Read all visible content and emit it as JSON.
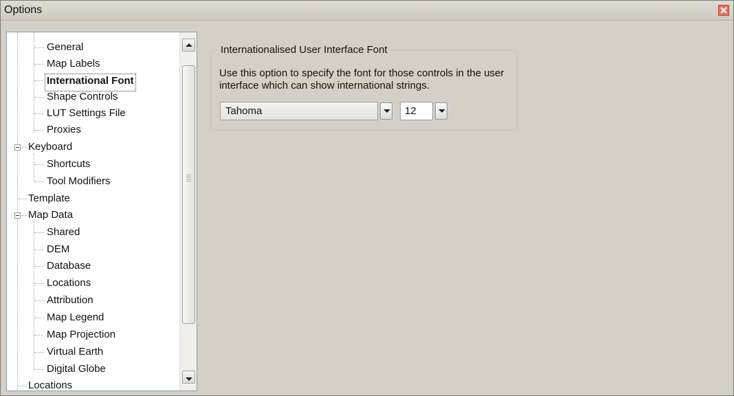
{
  "window": {
    "title": "Options"
  },
  "tree": {
    "items": [
      {
        "label": "General"
      },
      {
        "label": "Map Labels"
      },
      {
        "label": "International Font"
      },
      {
        "label": "Shape Controls"
      },
      {
        "label": "LUT Settings File"
      },
      {
        "label": "Proxies"
      },
      {
        "label": "Keyboard"
      },
      {
        "label": "Shortcuts"
      },
      {
        "label": "Tool Modifiers"
      },
      {
        "label": "Template"
      },
      {
        "label": "Map Data"
      },
      {
        "label": "Shared"
      },
      {
        "label": "DEM"
      },
      {
        "label": "Database"
      },
      {
        "label": "Locations"
      },
      {
        "label": "Attribution"
      },
      {
        "label": "Map Legend"
      },
      {
        "label": "Map Projection"
      },
      {
        "label": "Virtual Earth"
      },
      {
        "label": "Digital Globe"
      },
      {
        "label": "Locations"
      }
    ],
    "selected": "International Font"
  },
  "font_group": {
    "legend": "Internationalised User Interface Font",
    "description": "Use this option to specify the font for those controls in the user interface which can show international strings.",
    "font_value": "Tahoma",
    "size_value": "12"
  }
}
